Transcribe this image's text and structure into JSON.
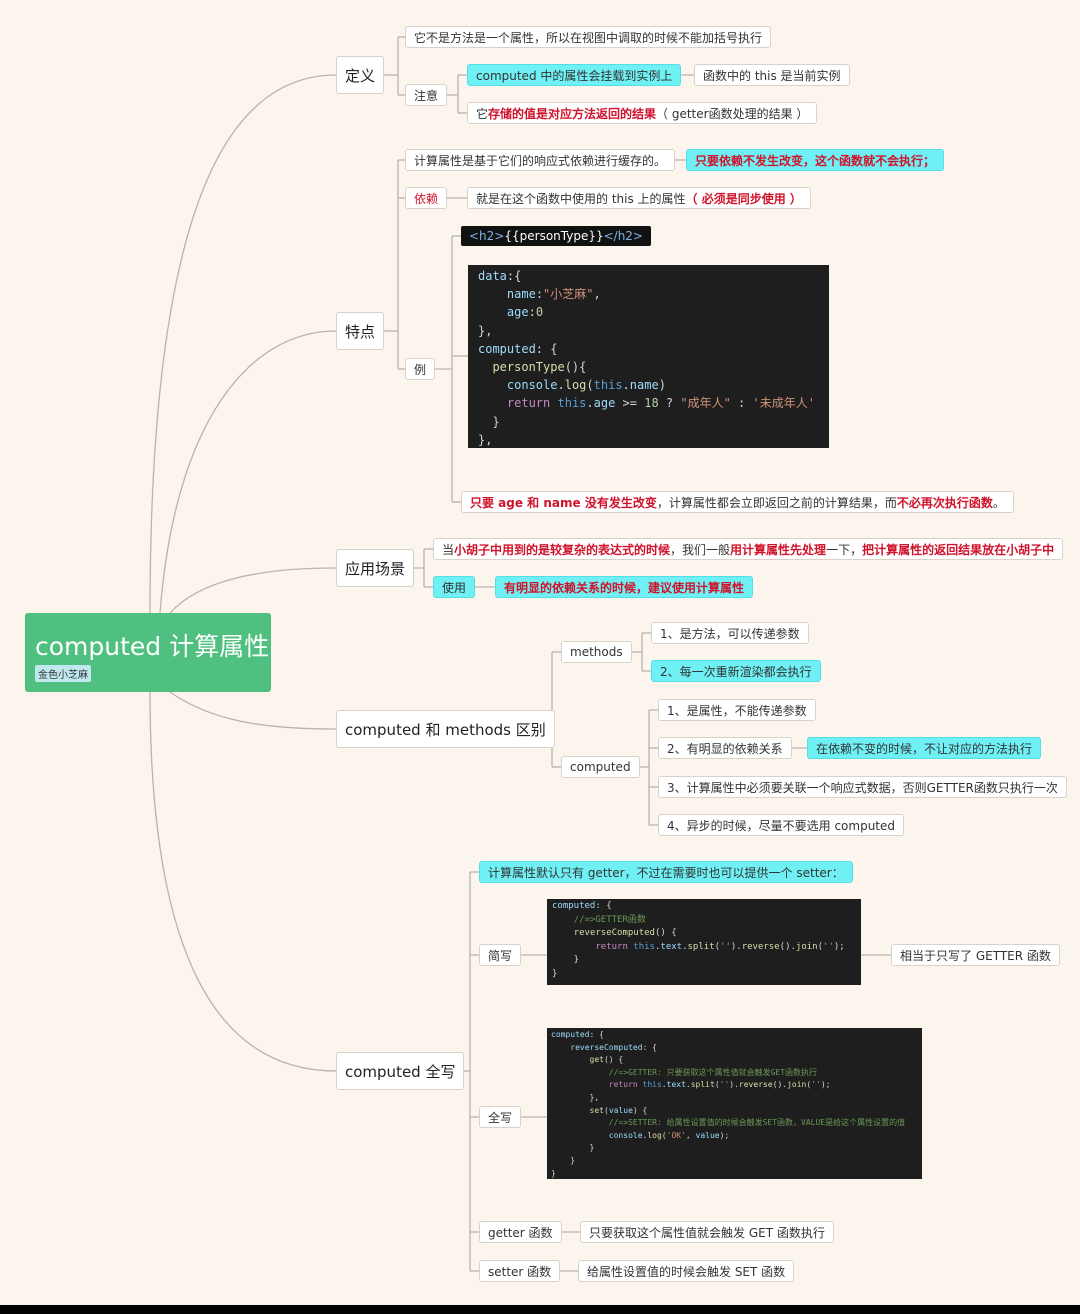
{
  "root": {
    "title": "computed 计算属性",
    "tag": "金色小芝麻"
  },
  "definition": {
    "label": "定义",
    "item1": "它不是方法是一个属性，所以在视图中调取的时候不能加括号执行",
    "note_label": "注意",
    "note1": "computed 中的属性会挂载到实例上",
    "note1_child": "函数中的 this 是当前实例",
    "note2_pre": "它",
    "note2_red": "存储的值是对应方法返回的结果",
    "note2_post": "（ getter函数处理的结果 ）"
  },
  "features": {
    "label": "特点",
    "cache": "计算属性是基于它们的响应式依赖进行缓存的。",
    "cache_child": "只要依赖不发生改变，这个函数就不会执行；",
    "dep_label": "依赖",
    "dep_pre": "就是在这个函数中使用的 this 上的属性",
    "dep_red": "（ 必须是同步使用 ）",
    "example_label": "例",
    "h2_open": "<h2>",
    "h2_expr": "{{personType}}",
    "h2_close": "</h2>",
    "result_red1": "只要 age 和 name 没有发生改变",
    "result_mid": "，计算属性都会立即返回之前的计算结果，而",
    "result_red2": "不必再次执行函数",
    "result_end": "。"
  },
  "scenario": {
    "label": "应用场景",
    "item_pre": "当",
    "item_red1": "小胡子中用到的是较复杂的表达式的时候",
    "item_mid": "，我们一般",
    "item_red2": "用计算属性先处理",
    "item_mid2": "一下，",
    "item_red3": "把计算属性的返回结果放在小胡子中",
    "use_label": "使用",
    "use_item": "有明显的依赖关系的时候，建议使用计算属性"
  },
  "compare": {
    "label": "computed 和 methods 区别",
    "methods_label": "methods",
    "m1": "1、是方法，可以传递参数",
    "m2": "2、每一次重新渲染都会执行",
    "computed_label": "computed",
    "c1": "1、是属性，不能传递参数",
    "c2": "2、有明显的依赖关系",
    "c2_child": "在依赖不变的时候，不让对应的方法执行",
    "c3": "3、计算属性中必须要关联一个响应式数据，否则GETTER函数只执行一次",
    "c4": "4、异步的时候，尽量不要选用 computed"
  },
  "full": {
    "label": "computed 全写",
    "intro": "计算属性默认只有 getter，不过在需要时也可以提供一个 setter：",
    "short_label": "简写",
    "short_note": "相当于只写了 GETTER 函数",
    "full_label": "全写",
    "getter_label": "getter 函数",
    "getter_desc": "只要获取这个属性值就会触发 GET 函数执行",
    "setter_label": "setter 函数",
    "setter_desc": "给属性设置值的时候会触发 SET 函数"
  },
  "code": {
    "example": [
      "data:{",
      "    name:\"小芝麻\",",
      "    age:0",
      "},",
      "computed: {",
      "  personType(){",
      "    console.log(this.name)",
      "    return this.age >= 18 ? \"成年人\" : '未成年人'",
      "  }",
      "},"
    ],
    "short": [
      "computed: {",
      "    //=>GETTER函数",
      "    reverseComputed() {",
      "        return this.text.split('').reverse().join('');",
      "    }",
      "}"
    ],
    "full": [
      "computed: {",
      "    reverseComputed: {",
      "        get() {",
      "            //=>GETTER: 只要获取这个属性值就会触发GET函数执行",
      "            return this.text.split('').reverse().join('');",
      "        },",
      "        set(value) {",
      "            //=>SETTER: 给属性设置值的时候会触发SET函数，VALUE是给这个属性设置的值",
      "            console.log('OK', value);",
      "        }",
      "    }",
      "}"
    ]
  },
  "colors": {
    "root": "#4fc07f",
    "cyan": "#6ff0f4",
    "red": "#d0132b",
    "background": "#fbf5ee",
    "line": "#b9b3aa"
  }
}
